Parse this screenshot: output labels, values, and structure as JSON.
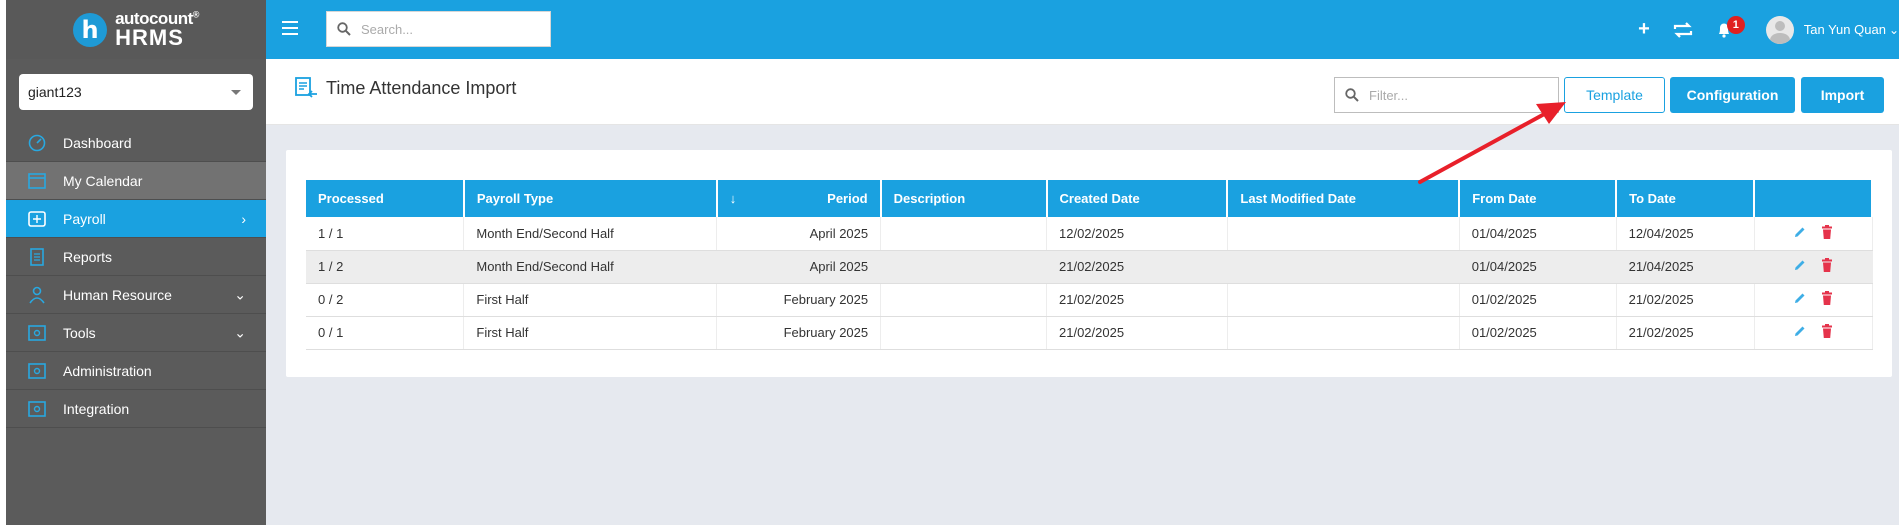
{
  "brand": {
    "name": "autocount",
    "trademark": "®",
    "product": "HRMS"
  },
  "company": {
    "selected": "giant123"
  },
  "sidebar": {
    "items": [
      {
        "label": "Dashboard",
        "icon": "dashboard-icon"
      },
      {
        "label": "My Calendar",
        "icon": "calendar-icon"
      },
      {
        "label": "Payroll",
        "icon": "payroll-icon"
      },
      {
        "label": "Reports",
        "icon": "reports-icon"
      },
      {
        "label": "Human Resource",
        "icon": "human-resource-icon"
      },
      {
        "label": "Tools",
        "icon": "tools-icon"
      },
      {
        "label": "Administration",
        "icon": "administration-icon"
      },
      {
        "label": "Integration",
        "icon": "integration-icon"
      }
    ]
  },
  "topbar": {
    "search_placeholder": "Search...",
    "notification_count": "1",
    "user_name": "Tan Yun Quan"
  },
  "page": {
    "title": "Time Attendance Import",
    "filter_placeholder": "Filter...",
    "buttons": {
      "template": "Template",
      "configuration": "Configuration",
      "import": "Import"
    }
  },
  "table": {
    "columns": [
      "Processed",
      "Payroll Type",
      "Period",
      "Description",
      "Created Date",
      "Last Modified Date",
      "From Date",
      "To Date"
    ],
    "rows": [
      [
        "1 / 1",
        "Month End/Second Half",
        "April 2025",
        "",
        "12/02/2025",
        "",
        "01/04/2025",
        "12/04/2025"
      ],
      [
        "1 / 2",
        "Month End/Second Half",
        "April 2025",
        "",
        "21/02/2025",
        "",
        "01/04/2025",
        "21/04/2025"
      ],
      [
        "0 / 2",
        "First Half",
        "February 2025",
        "",
        "21/02/2025",
        "",
        "01/02/2025",
        "21/02/2025"
      ],
      [
        "0 / 1",
        "First Half",
        "February 2025",
        "",
        "21/02/2025",
        "",
        "01/02/2025",
        "21/02/2025"
      ]
    ]
  },
  "colors": {
    "primary": "#1aa1e0",
    "sidebar": "#5b5b5b",
    "delete": "#e5334b",
    "annotation_arrow": "#e8202a"
  }
}
